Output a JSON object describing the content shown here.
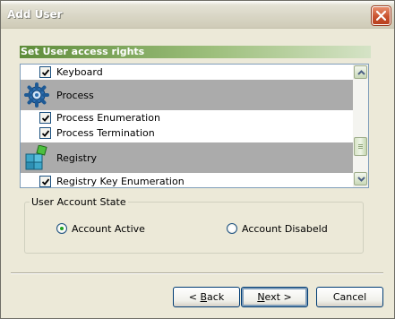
{
  "window": {
    "title": "Add User"
  },
  "rights": {
    "header": "Set User access rights",
    "items": [
      {
        "kind": "check",
        "label": "Keyboard",
        "checked": true
      },
      {
        "kind": "group",
        "label": "Process",
        "icon": "gear-icon"
      },
      {
        "kind": "check",
        "label": "Process Enumeration",
        "checked": true
      },
      {
        "kind": "check",
        "label": "Process Termination",
        "checked": true
      },
      {
        "kind": "group",
        "label": "Registry",
        "icon": "registry-cubes-icon"
      },
      {
        "kind": "check",
        "label": "Registry Key Enumeration",
        "checked": true
      }
    ]
  },
  "account_state": {
    "legend": "User Account State",
    "options": [
      {
        "label": "Account Active",
        "selected": true
      },
      {
        "label": "Account Disabeld",
        "selected": false
      }
    ]
  },
  "buttons": {
    "back": {
      "pre": "< ",
      "mnemonic": "B",
      "post": "ack"
    },
    "next": {
      "pre": "",
      "mnemonic": "N",
      "post": "ext >"
    },
    "cancel": "Cancel"
  },
  "colors": {
    "header_accent": "#5E8C3A",
    "group_row": "#ABABAB",
    "radio_selected": "#21A121",
    "close_button": "#C9532F"
  }
}
